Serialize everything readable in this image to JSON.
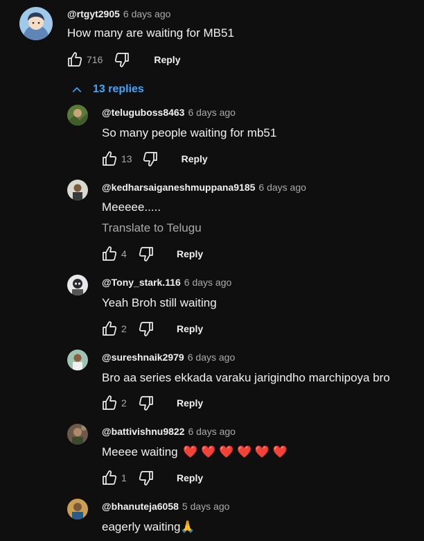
{
  "top_comment": {
    "handle": "@rtgyt2905",
    "time": "6 days ago",
    "text": "How many are waiting for MB51",
    "likes": "716",
    "reply_label": "Reply"
  },
  "replies_toggle": {
    "label": "13 replies"
  },
  "replies": [
    {
      "handle": "@teluguboss8463",
      "time": "6 days ago",
      "text": "So many people waiting for mb51",
      "likes": "13",
      "reply_label": "Reply"
    },
    {
      "handle": "@kedharsaiganeshmuppana9185",
      "time": "6 days ago",
      "text": "Meeeee.....",
      "translate": "Translate to Telugu",
      "likes": "4",
      "reply_label": "Reply"
    },
    {
      "handle": "@Tony_stark.116",
      "time": "6 days ago",
      "text": "Yeah Broh still waiting",
      "likes": "2",
      "reply_label": "Reply"
    },
    {
      "handle": "@sureshnaik2979",
      "time": "6 days ago",
      "text": "Bro aa series ekkada varaku jarigindho marchipoya bro",
      "likes": "2",
      "reply_label": "Reply"
    },
    {
      "handle": "@battivishnu9822",
      "time": "6 days ago",
      "text": "Meeee waiting",
      "hearts": "❤️ ❤️ ❤️ ❤️ ❤️ ❤️",
      "likes": "1",
      "reply_label": "Reply"
    },
    {
      "handle": "@bhanuteja6058",
      "time": "5 days ago",
      "text": "eagerly waiting",
      "emoji": "🙏"
    }
  ],
  "colors": {
    "background": "#0f0f0f",
    "text": "#f1f1f1",
    "secondary": "#aaaaaa",
    "link": "#3ea6ff"
  }
}
